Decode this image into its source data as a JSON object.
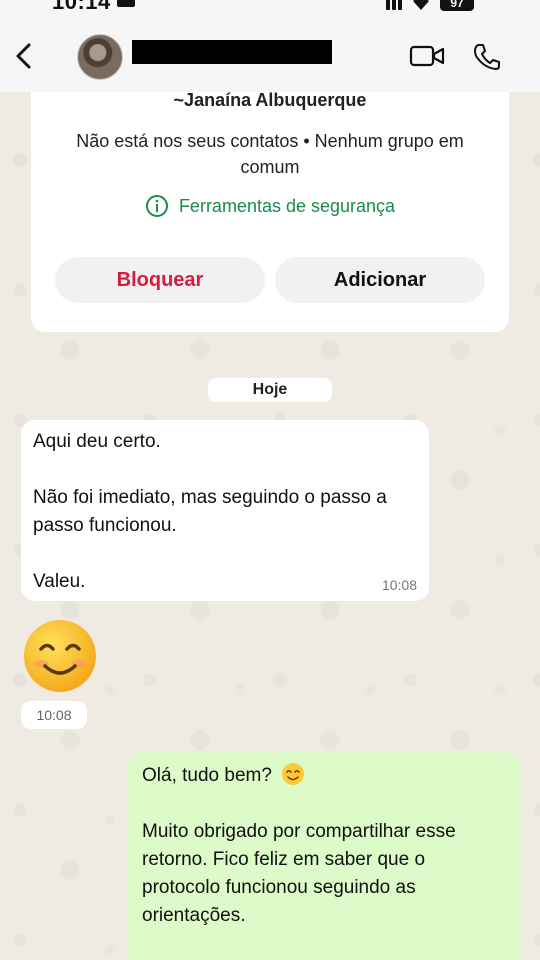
{
  "status_bar": {
    "time": "10:14",
    "battery": "97"
  },
  "header": {
    "contact_name": ""
  },
  "info_card": {
    "name": "~Janaína Albuquerque",
    "subtitle": "Não está nos seus contatos • Nenhum grupo em comum",
    "safety_label": "Ferramentas de segurança",
    "block_label": "Bloquear",
    "add_label": "Adicionar"
  },
  "chat": {
    "date_label": "Hoje",
    "incoming_message": {
      "line1": "Aqui deu certo.",
      "line2": "Não foi imediato, mas seguindo o passo a passo funcionou.",
      "line3": "Valeu.",
      "time": "10:08"
    },
    "emoji_message_time": "10:08",
    "outgoing_message": {
      "line1": "Olá, tudo bem?",
      "line2": "Muito obrigado por compartilhar esse retorno. Fico feliz em saber que o protocolo funcionou seguindo as orientações."
    }
  },
  "colors": {
    "accent_green": "#1a8b4c",
    "block_red": "#d41c3e",
    "outgoing_bubble": "#dcfbc8",
    "chat_background": "#efeae2"
  },
  "icons": [
    "back-chevron-icon",
    "video-call-icon",
    "phone-call-icon",
    "info-circle-icon",
    "smiling-face-emoji-icon"
  ]
}
